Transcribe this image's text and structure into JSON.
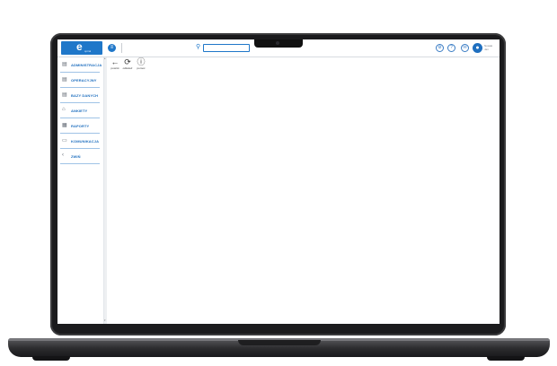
{
  "app": {
    "logo_letter": "e",
    "logo_sub": "spiral",
    "search_placeholder": "",
    "user_name": "Nowak",
    "user_sub": "Jan",
    "avatar_initial": "●"
  },
  "sidebar": {
    "items": [
      {
        "label": "ADMINISTRACJA",
        "icon": "document-icon"
      },
      {
        "label": "OPERACYJNY",
        "icon": "document-icon"
      },
      {
        "label": "BAZY DANYCH",
        "icon": "document-icon"
      },
      {
        "label": "ANKIETY",
        "icon": "home-icon"
      },
      {
        "label": "RAPORTY",
        "icon": "report-icon"
      },
      {
        "label": "KOMUNIKACJA",
        "icon": "message-icon"
      },
      {
        "label": "ZWIŃ",
        "icon": "chevron-left-icon"
      }
    ]
  },
  "toolbar": {
    "back_label": "powrót",
    "refresh_label": "odśwież",
    "help_label": "pomoc"
  },
  "colors": {
    "accent": "#1f77c9",
    "nav_text": "#1f6fbf",
    "divider": "#9fc3e6"
  }
}
